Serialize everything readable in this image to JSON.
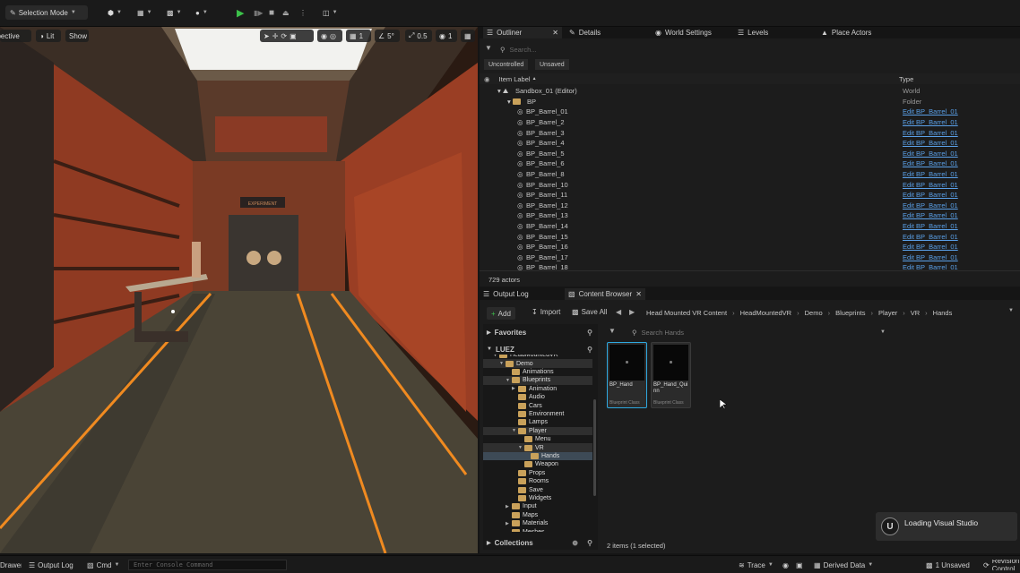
{
  "toolbar": {
    "mode_label": "Selection Mode"
  },
  "viewport": {
    "view_mode": "Perspective",
    "lit_label": "Lit",
    "show_label": "Show",
    "snap_angle": "5°",
    "snap_scale": "0.5",
    "camera_speed": "1",
    "door_sign": "EXPERIMENT"
  },
  "outliner": {
    "tabs": [
      "Outliner",
      "Details",
      "World Settings",
      "Levels",
      "Place Actors"
    ],
    "search_placeholder": "Search...",
    "filters": [
      "Uncontrolled",
      "Unsaved"
    ],
    "col_label": "Item Label",
    "col_type": "Type",
    "rows": [
      {
        "label": "Sandbox_01 (Editor)",
        "type": "World",
        "level": 0
      },
      {
        "label": "BP",
        "type": "Folder",
        "level": 1
      },
      {
        "label": "BP_Barrel_01",
        "type": "Edit BP_Barrel_01",
        "level": 2
      },
      {
        "label": "BP_Barrel_2",
        "type": "Edit BP_Barrel_01",
        "level": 2
      },
      {
        "label": "BP_Barrel_3",
        "type": "Edit BP_Barrel_01",
        "level": 2
      },
      {
        "label": "BP_Barrel_4",
        "type": "Edit BP_Barrel_01",
        "level": 2
      },
      {
        "label": "BP_Barrel_5",
        "type": "Edit BP_Barrel_01",
        "level": 2
      },
      {
        "label": "BP_Barrel_6",
        "type": "Edit BP_Barrel_01",
        "level": 2
      },
      {
        "label": "BP_Barrel_8",
        "type": "Edit BP_Barrel_01",
        "level": 2
      },
      {
        "label": "BP_Barrel_10",
        "type": "Edit BP_Barrel_01",
        "level": 2
      },
      {
        "label": "BP_Barrel_11",
        "type": "Edit BP_Barrel_01",
        "level": 2
      },
      {
        "label": "BP_Barrel_12",
        "type": "Edit BP_Barrel_01",
        "level": 2
      },
      {
        "label": "BP_Barrel_13",
        "type": "Edit BP_Barrel_01",
        "level": 2
      },
      {
        "label": "BP_Barrel_14",
        "type": "Edit BP_Barrel_01",
        "level": 2
      },
      {
        "label": "BP_Barrel_15",
        "type": "Edit BP_Barrel_01",
        "level": 2
      },
      {
        "label": "BP_Barrel_16",
        "type": "Edit BP_Barrel_01",
        "level": 2
      },
      {
        "label": "BP_Barrel_17",
        "type": "Edit BP_Barrel_01",
        "level": 2
      },
      {
        "label": "BP_Barrel_18",
        "type": "Edit BP_Barrel_01",
        "level": 2
      }
    ],
    "actor_count": "729 actors"
  },
  "content_browser": {
    "tabs": [
      "Output Log",
      "Content Browser"
    ],
    "add_label": "Add",
    "import_label": "Import",
    "save_all_label": "Save All",
    "breadcrumb": [
      "Head Mounted VR Content",
      "HeadMountedVR",
      "Demo",
      "Blueprints",
      "Player",
      "VR",
      "Hands"
    ],
    "favorites_label": "Favorites",
    "project_label": "LUEZ",
    "search_placeholder": "Search Hands",
    "tree": [
      {
        "label": "HeadMountedVR",
        "level": 1
      },
      {
        "label": "Demo",
        "level": 2
      },
      {
        "label": "Animations",
        "level": 3
      },
      {
        "label": "Blueprints",
        "level": 3
      },
      {
        "label": "Animation",
        "level": 4
      },
      {
        "label": "Audio",
        "level": 4
      },
      {
        "label": "Cars",
        "level": 4
      },
      {
        "label": "Environment",
        "level": 4
      },
      {
        "label": "Lamps",
        "level": 4
      },
      {
        "label": "Player",
        "level": 4
      },
      {
        "label": "Menu",
        "level": 5
      },
      {
        "label": "VR",
        "level": 5
      },
      {
        "label": "Hands",
        "level": 6
      },
      {
        "label": "Weapon",
        "level": 5
      },
      {
        "label": "Props",
        "level": 4
      },
      {
        "label": "Rooms",
        "level": 4
      },
      {
        "label": "Save",
        "level": 4
      },
      {
        "label": "Widgets",
        "level": 4
      },
      {
        "label": "Input",
        "level": 3
      },
      {
        "label": "Maps",
        "level": 3
      },
      {
        "label": "Materials",
        "level": 3
      },
      {
        "label": "Meshes",
        "level": 3
      }
    ],
    "collections_label": "Collections",
    "assets": [
      {
        "name": "BP_Hand",
        "class": "Blueprint Class"
      },
      {
        "name": "BP_Hand_Quinn",
        "class": "Blueprint Class"
      }
    ],
    "item_count": "2 items (1 selected)"
  },
  "toast": {
    "text": "Loading Visual Studio"
  },
  "statusbar": {
    "drawer_label": "Drawer",
    "output_log_label": "Output Log",
    "cmd_label": "Cmd",
    "console_placeholder": "Enter Console Command",
    "trace_label": "Trace",
    "derived_data_label": "Derived Data",
    "unsaved_label": "1 Unsaved",
    "revision_label": "Revision Control"
  },
  "colors": {
    "accent": "#2ea8e0",
    "play_green": "#3cc24a",
    "link_blue": "#5aa0e8",
    "folder": "#c9a15a"
  }
}
